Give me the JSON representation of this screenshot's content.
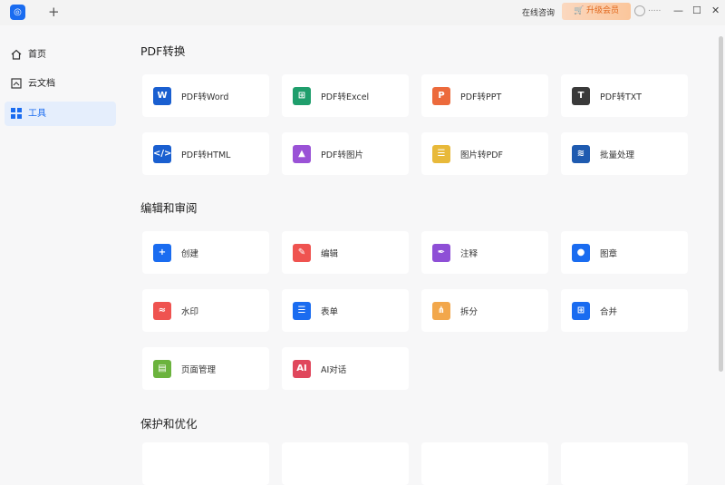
{
  "titlebar": {
    "new_tab": "+",
    "consult": "在线咨询",
    "upgrade": "升级会员",
    "user": "·····",
    "minimize": "—",
    "maximize": "☐",
    "close": "✕"
  },
  "sidebar": {
    "items": [
      {
        "label": "首页",
        "icon": "home-icon"
      },
      {
        "label": "云文档",
        "icon": "cloud-doc-icon"
      },
      {
        "label": "工具",
        "icon": "tools-icon"
      }
    ]
  },
  "sections": [
    {
      "title": "PDF转换",
      "items": [
        {
          "label": "PDF转Word",
          "color": "#1a5fd0",
          "glyph": "W"
        },
        {
          "label": "PDF转Excel",
          "color": "#1f9e6c",
          "glyph": "⊞"
        },
        {
          "label": "PDF转PPT",
          "color": "#ec6a3c",
          "glyph": "P"
        },
        {
          "label": "PDF转TXT",
          "color": "#3a3a3a",
          "glyph": "T"
        },
        {
          "label": "PDF转HTML",
          "color": "#1a5fd0",
          "glyph": "</>"
        },
        {
          "label": "PDF转图片",
          "color": "#9a52d6",
          "glyph": "▲"
        },
        {
          "label": "图片转PDF",
          "color": "#e8b93a",
          "glyph": "☰"
        },
        {
          "label": "批量处理",
          "color": "#1f5bb0",
          "glyph": "≋"
        }
      ]
    },
    {
      "title": "编辑和审阅",
      "items": [
        {
          "label": "创建",
          "color": "#1a6cf0",
          "glyph": "+"
        },
        {
          "label": "编辑",
          "color": "#ef5350",
          "glyph": "✎"
        },
        {
          "label": "注释",
          "color": "#8e4fd6",
          "glyph": "✒"
        },
        {
          "label": "图章",
          "color": "#1a6cf0",
          "glyph": "●"
        },
        {
          "label": "水印",
          "color": "#ef5350",
          "glyph": "≈"
        },
        {
          "label": "表单",
          "color": "#1a6cf0",
          "glyph": "☰"
        },
        {
          "label": "拆分",
          "color": "#f2a74b",
          "glyph": "⋔"
        },
        {
          "label": "合并",
          "color": "#1a6cf0",
          "glyph": "⊞"
        },
        {
          "label": "页面管理",
          "color": "#6bb33d",
          "glyph": "▤"
        },
        {
          "label": "AI对话",
          "color": "#e0475c",
          "glyph": "AI"
        }
      ]
    },
    {
      "title": "保护和优化",
      "items": []
    }
  ]
}
